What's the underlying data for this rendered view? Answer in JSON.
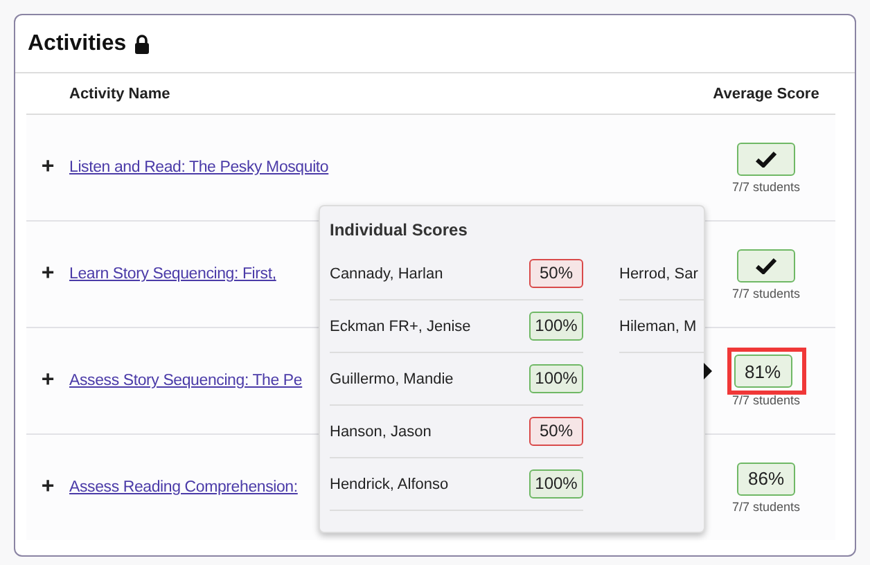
{
  "card": {
    "title": "Activities",
    "locked": true
  },
  "table": {
    "columns": [
      "Activity Name",
      "Average Score"
    ],
    "rows": [
      {
        "toggle": "+",
        "name": "Listen and Read: The Pesky Mosquito",
        "score": {
          "kind": "check"
        },
        "students": "7/7 students",
        "highlighted": false
      },
      {
        "toggle": "+",
        "name": "Learn Story Sequencing: First,",
        "score": {
          "kind": "check"
        },
        "students": "7/7 students",
        "highlighted": false
      },
      {
        "toggle": "+",
        "name": "Assess Story Sequencing: The Pe",
        "score": {
          "kind": "percent",
          "text": "81%"
        },
        "students": "7/7 students",
        "highlighted": true
      },
      {
        "toggle": "+",
        "name": "Assess Reading Comprehension:",
        "score": {
          "kind": "percent",
          "text": "86%"
        },
        "students": "7/7 students",
        "highlighted": false
      }
    ]
  },
  "popover": {
    "title": "Individual Scores",
    "columns": [
      [
        {
          "name": "Cannady, Harlan",
          "score": "50%",
          "passed": false
        },
        {
          "name": "Eckman FR+, Jenise",
          "score": "100%",
          "passed": true
        },
        {
          "name": "Guillermo, Mandie",
          "score": "100%",
          "passed": true
        },
        {
          "name": "Hanson, Jason",
          "score": "50%",
          "passed": false
        },
        {
          "name": "Hendrick, Alfonso",
          "score": "100%",
          "passed": true
        }
      ],
      [
        {
          "name": "Herrod, Sar"
        },
        {
          "name": "Hileman, M"
        }
      ]
    ]
  }
}
